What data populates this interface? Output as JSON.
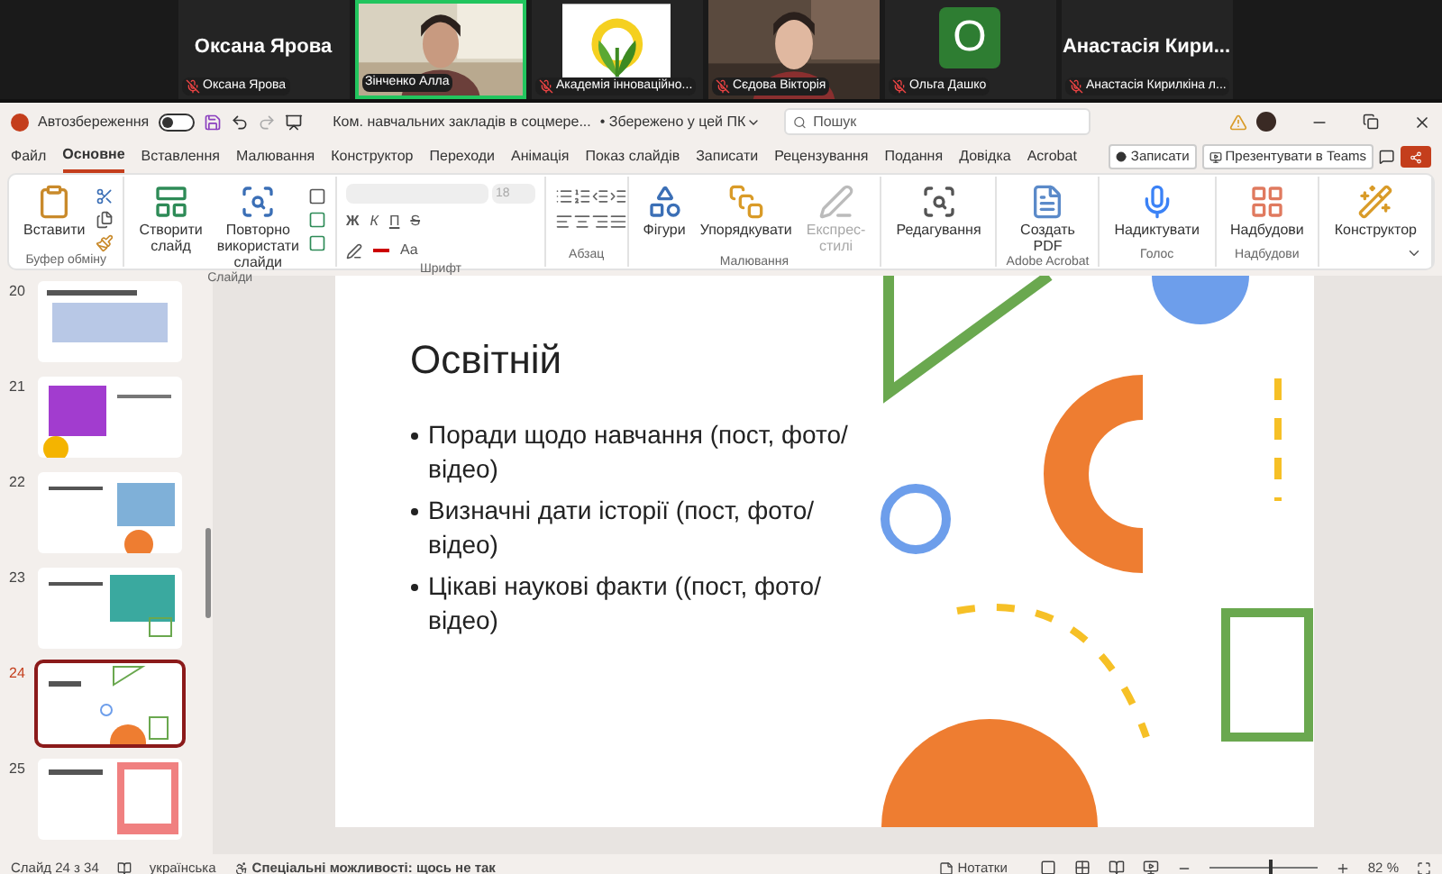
{
  "participants": [
    {
      "kind": "name",
      "display": "Оксана Ярова",
      "label": "Оксана Ярова",
      "muted": true,
      "speaking": false
    },
    {
      "kind": "video",
      "label": "Зінченко Алла",
      "muted": false,
      "speaking": true
    },
    {
      "kind": "logo",
      "label": "Академія інноваційно...",
      "muted": true,
      "speaking": false
    },
    {
      "kind": "video",
      "label": "Сєдова Вікторія",
      "muted": true,
      "speaking": false
    },
    {
      "kind": "avatar",
      "display": "О",
      "label": "Ольга Дашко",
      "muted": true,
      "speaking": false
    },
    {
      "kind": "name",
      "display": "Анастасія Кири...",
      "label": "Анастасія Кирилкіна л...",
      "muted": true,
      "speaking": false
    }
  ],
  "titlebar": {
    "autosave_label": "Автозбереження",
    "autosave_on": false,
    "document": "Ком. навчальних закладів в соцмере...",
    "save_state": "• Збережено у цей ПК",
    "search_placeholder": "Пошук"
  },
  "tabs": [
    {
      "label": "Файл",
      "selected": false
    },
    {
      "label": "Основне",
      "selected": true
    },
    {
      "label": "Вставлення",
      "selected": false
    },
    {
      "label": "Малювання",
      "selected": false
    },
    {
      "label": "Конструктор",
      "selected": false
    },
    {
      "label": "Переходи",
      "selected": false
    },
    {
      "label": "Анімація",
      "selected": false
    },
    {
      "label": "Показ слайдів",
      "selected": false
    },
    {
      "label": "Записати",
      "selected": false
    },
    {
      "label": "Рецензування",
      "selected": false
    },
    {
      "label": "Подання",
      "selected": false
    },
    {
      "label": "Довідка",
      "selected": false
    },
    {
      "label": "Acrobat",
      "selected": false
    }
  ],
  "tab_buttons": [
    "Записати",
    "Презентувати в Teams"
  ],
  "ribbon": {
    "groups": [
      {
        "kind": "clipboard",
        "label": "Буфер обміну",
        "buttons": [
          {
            "label": "Вставити",
            "disabled": false
          }
        ]
      },
      {
        "kind": "slides",
        "label": "Слайди",
        "buttons": [
          {
            "label": "Створити слайд",
            "disabled": false
          },
          {
            "label": "Повторно використати слайди",
            "disabled": false
          }
        ]
      },
      {
        "kind": "font",
        "label": "Шрифт",
        "font_size": "18",
        "format_buttons": [
          "Ж",
          "К",
          "П",
          "S"
        ],
        "case_button": "Aa"
      },
      {
        "kind": "paragraph",
        "label": "Абзац"
      },
      {
        "kind": "drawing",
        "label": "Малювання",
        "buttons": [
          {
            "label": "Фігури",
            "disabled": false
          },
          {
            "label": "Упорядкувати",
            "disabled": false
          },
          {
            "label": "Експрес-стилі",
            "disabled": true
          }
        ]
      },
      {
        "kind": "large",
        "buttons": [
          {
            "label": "Редагування",
            "disabled": false
          }
        ]
      },
      {
        "kind": "large",
        "label": "Adobe Acrobat",
        "buttons": [
          {
            "label": "Создать PDF",
            "disabled": false
          }
        ]
      },
      {
        "kind": "large",
        "label": "Голос",
        "buttons": [
          {
            "label": "Надиктувати",
            "disabled": false
          }
        ]
      },
      {
        "kind": "large",
        "label": "Надбудови",
        "buttons": [
          {
            "label": "Надбудови",
            "disabled": false
          }
        ]
      },
      {
        "kind": "large",
        "buttons": [
          {
            "label": "Конструктор",
            "disabled": false
          }
        ]
      }
    ]
  },
  "thumbnails": [
    {
      "number": "20",
      "selected": false
    },
    {
      "number": "21",
      "selected": false
    },
    {
      "number": "22",
      "selected": false
    },
    {
      "number": "23",
      "selected": false
    },
    {
      "number": "24",
      "selected": true
    },
    {
      "number": "25",
      "selected": false
    }
  ],
  "slide": {
    "title": "Освітній",
    "bullets": [
      "Поради щодо навчання (пост, фото/відео)",
      "Визначні дати історії (пост, фото/відео)",
      "Цікаві наукові факти ((пост, фото/відео)"
    ]
  },
  "status_bar": {
    "slide": "Слайд 24 з 34",
    "language": "українська",
    "accessibility": "Спеціальні можливості: щось не так",
    "notes": "Нотатки",
    "zoom": "82 %",
    "zoom_slider": {
      "level": 0.55
    }
  }
}
